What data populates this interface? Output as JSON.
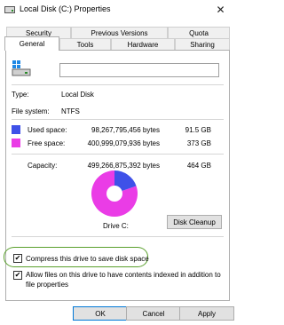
{
  "window": {
    "title": "Local Disk (C:) Properties"
  },
  "tabs": {
    "row1": [
      "Security",
      "Previous Versions",
      "Quota"
    ],
    "row2": [
      "General",
      "Tools",
      "Hardware",
      "Sharing"
    ],
    "active": "General"
  },
  "general": {
    "name_value": "",
    "type_label": "Type:",
    "type_value": "Local Disk",
    "fs_label": "File system:",
    "fs_value": "NTFS",
    "used_label": "Used space:",
    "used_bytes": "98,267,795,456 bytes",
    "used_gb": "91.5 GB",
    "free_label": "Free space:",
    "free_bytes": "400,999,079,936 bytes",
    "free_gb": "373 GB",
    "capacity_label": "Capacity:",
    "capacity_bytes": "499,266,875,392 bytes",
    "capacity_gb": "464 GB",
    "drive_label": "Drive C:",
    "cleanup_label": "Disk Cleanup",
    "compress_label": "Compress this drive to save disk space",
    "compress_checked": true,
    "index_label_line1": "Allow files on this drive to have contents indexed in addition to",
    "index_label_line2": "file properties",
    "index_checked": true
  },
  "chart_data": {
    "type": "pie",
    "categories": [
      "Used space",
      "Free space"
    ],
    "values": [
      98267795456,
      400999079936
    ],
    "colors": [
      "#3f51e8",
      "#ea3ce6"
    ]
  },
  "footer": {
    "ok": "OK",
    "cancel": "Cancel",
    "apply": "Apply"
  },
  "colors": {
    "used": "#3f51e8",
    "free": "#ea3ce6",
    "highlight": "#5aa02c",
    "ok_border": "#0078d7"
  },
  "icons": {
    "title_icon": "drive-icon",
    "drive_icon": "drive-icon",
    "close_icon": "close-icon"
  }
}
